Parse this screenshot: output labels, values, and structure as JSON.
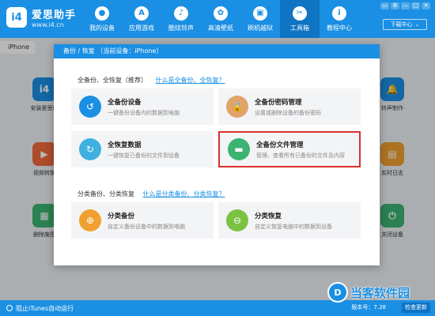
{
  "app": {
    "logo_mark": "i4",
    "name": "爱思助手",
    "url": "www.i4.cn"
  },
  "nav": [
    {
      "label": "我的设备",
      "icon": "apple-icon",
      "glyph": ""
    },
    {
      "label": "应用游戏",
      "icon": "app-store-icon",
      "glyph": "A"
    },
    {
      "label": "酷炫铃声",
      "icon": "bell-icon",
      "glyph": "♪"
    },
    {
      "label": "高清壁纸",
      "icon": "flower-icon",
      "glyph": "✿"
    },
    {
      "label": "刷机越狱",
      "icon": "box-icon",
      "glyph": "▣"
    },
    {
      "label": "工具箱",
      "icon": "tools-icon",
      "glyph": "✂"
    },
    {
      "label": "教程中心",
      "icon": "info-icon",
      "glyph": "i"
    }
  ],
  "window_controls": [
    "▭",
    "⚙",
    "—",
    "□",
    "✕"
  ],
  "download": {
    "label": "下载中心",
    "icon": "chevron-down-icon",
    "glyph": "⌄"
  },
  "device_tab": "iPhone",
  "background_tools": [
    {
      "label": "安装爱思移",
      "color": "#1a8fe3",
      "glyph": "i4"
    },
    {
      "label": "视频转换",
      "color": "#f06a3c",
      "glyph": "▶"
    },
    {
      "label": "删除废图",
      "color": "#3cb371",
      "glyph": "▦"
    },
    {
      "label": "铃声制作",
      "color": "#1a8fe3",
      "glyph": "🔔"
    },
    {
      "label": "实时日志",
      "color": "#f0a030",
      "glyph": "▤"
    },
    {
      "label": "关闭设备",
      "color": "#3cb371",
      "glyph": "⏻"
    }
  ],
  "modal": {
    "title": "备份 / 恢复  （当前设备：iPhone）",
    "section1": {
      "title": "全备份、全恢复（推荐）",
      "link": "什么是全备份、全恢复？"
    },
    "section2": {
      "title": "分类备份、分类恢复",
      "link": "什么是分类备份、分类恢复？"
    },
    "cards": [
      {
        "title": "全备份设备",
        "desc": "一键备份设备内的数据到电脑",
        "color": "#1a8fe3",
        "icon": "backup-clock-icon",
        "glyph": "↺"
      },
      {
        "title": "全备份密码管理",
        "desc": "设置或删除设备的备份密码",
        "color": "#e0a46a",
        "icon": "lock-icon",
        "glyph": "🔒"
      },
      {
        "title": "全恢复数据",
        "desc": "一键恢复已备份的文件到设备",
        "color": "#3fb0e0",
        "icon": "restore-icon",
        "glyph": "↻"
      },
      {
        "title": "全备份文件管理",
        "desc": "管理、查看所有已备份的文件及内容",
        "color": "#3cb371",
        "icon": "folder-icon",
        "glyph": "▬"
      },
      {
        "title": "分类备份",
        "desc": "自定义备份设备中的数据到电脑",
        "color": "#f0a030",
        "icon": "category-backup-icon",
        "glyph": "⊕"
      },
      {
        "title": "分类恢复",
        "desc": "自定义恢复电脑中的数据到设备",
        "color": "#7cc242",
        "icon": "category-restore-icon",
        "glyph": "⊖"
      }
    ]
  },
  "bottom": {
    "itunes": "阻止iTunes自动运行",
    "version": "版本号：7.28",
    "check_update": "检查更新"
  },
  "watermark": {
    "badge": "D",
    "text": "当客软件园"
  }
}
